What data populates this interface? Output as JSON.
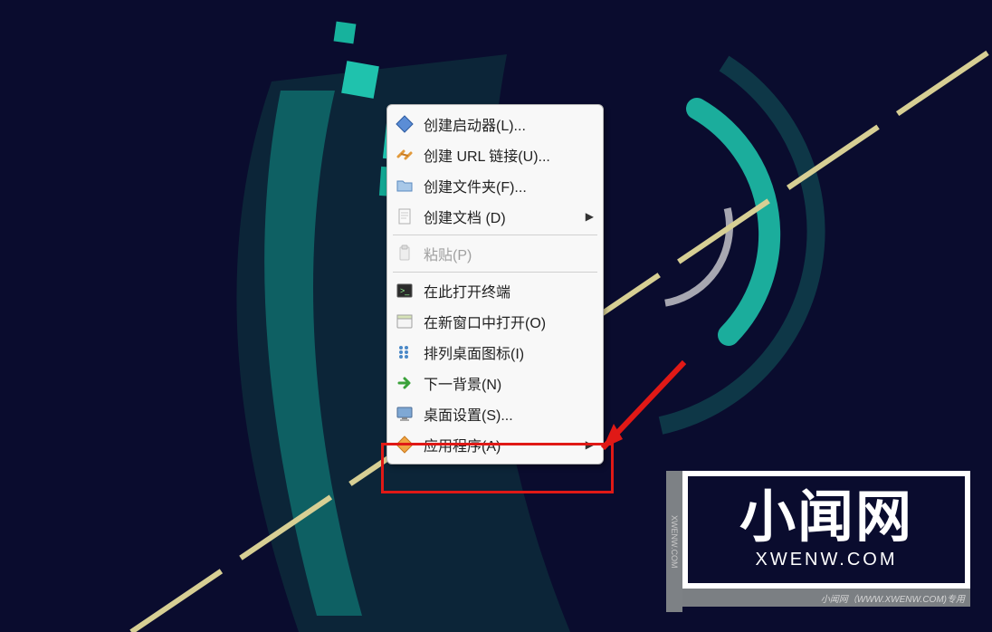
{
  "menu": {
    "items": [
      {
        "label": "创建启动器(L)...",
        "icon": "diamond-blue",
        "interactable": true,
        "disabled": false,
        "submenu": false
      },
      {
        "label": "创建 URL 链接(U)...",
        "icon": "link-orange",
        "interactable": true,
        "disabled": false,
        "submenu": false
      },
      {
        "label": "创建文件夹(F)...",
        "icon": "folder-blue",
        "interactable": true,
        "disabled": false,
        "submenu": false
      },
      {
        "label": "创建文档 (D)",
        "icon": "document",
        "interactable": true,
        "disabled": false,
        "submenu": true
      }
    ],
    "items2": [
      {
        "label": "粘贴(P)",
        "icon": "clipboard",
        "interactable": false,
        "disabled": true,
        "submenu": false
      }
    ],
    "items3": [
      {
        "label": "在此打开终端",
        "icon": "terminal",
        "interactable": true,
        "disabled": false,
        "submenu": false
      },
      {
        "label": "在新窗口中打开(O)",
        "icon": "window",
        "interactable": true,
        "disabled": false,
        "submenu": false
      },
      {
        "label": "排列桌面图标(I)",
        "icon": "arrange",
        "interactable": true,
        "disabled": false,
        "submenu": false
      },
      {
        "label": "下一背景(N)",
        "icon": "next-green",
        "interactable": true,
        "disabled": false,
        "submenu": false
      },
      {
        "label": "桌面设置(S)...",
        "icon": "display",
        "interactable": true,
        "disabled": false,
        "submenu": false
      },
      {
        "label": "应用程序(A)",
        "icon": "diamond-orange",
        "interactable": true,
        "disabled": false,
        "submenu": true
      }
    ]
  },
  "watermark": {
    "big": "小闻网",
    "sub": "XWENW.COM",
    "vert": "XWENW.COM",
    "footer": "小闻网（WWW.XWENW.COM)专用"
  }
}
